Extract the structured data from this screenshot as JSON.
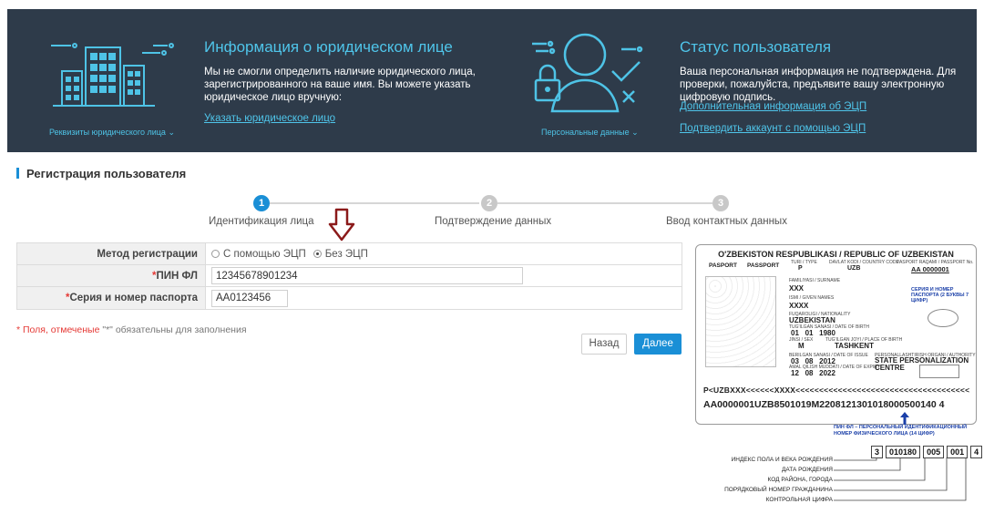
{
  "banner": {
    "legal": {
      "icon_caption": "Реквизиты юридического лица",
      "title": "Информация о юридическом лице",
      "text": "Мы не смогли определить наличие юридического лица, зарегистрированного на ваше имя. Вы можете указать юридическое лицо вручную:",
      "link": "Указать юридическое лицо"
    },
    "status": {
      "icon_caption": "Персональные данные",
      "title": "Статус пользователя",
      "text": "Ваша персональная информация не подтверждена. Для проверки, пожалуйста, предъявите вашу электронную цифровую подпись.",
      "info_link": "Дополнительная информация об ЭЦП",
      "confirm_link": "Подтвердить аккаунт с помощью ЭЦП"
    },
    "colors": {
      "background": "#2e3b4a",
      "accent": "#4fc5ea"
    }
  },
  "page": {
    "section_title": "Регистрация пользователя"
  },
  "stepper": {
    "steps": [
      {
        "number": "1",
        "label": "Идентификация лица",
        "state": "active"
      },
      {
        "number": "2",
        "label": "Подтверждение данных",
        "state": "inactive"
      },
      {
        "number": "3",
        "label": "Ввод контактных данных",
        "state": "inactive"
      }
    ]
  },
  "form": {
    "method": {
      "label": "Метод регистрации",
      "options": [
        "С помощью ЭЦП",
        "Без ЭЦП"
      ],
      "selected": "Без ЭЦП"
    },
    "pin": {
      "required_mark": "*",
      "label": "ПИН ФЛ",
      "value": "12345678901234"
    },
    "passport": {
      "required_mark": "*",
      "label": "Серия и номер паспорта",
      "value": "AA0123456"
    },
    "required_note_prefix": "* Поля, отмеченые ",
    "required_note_star": "\"*\"",
    "required_note_suffix": " обязательны для заполнения",
    "back_button": "Назад",
    "next_button": "Далее"
  },
  "passport_sample": {
    "header": "O'ZBEKISTON RESPUBLIKASI / REPUBLIC OF UZBEKISTAN",
    "pasport_label": "PASPORT",
    "passport_label": "PASSPORT",
    "type_label": "TURI / TYPE",
    "type_value": "P",
    "country_label": "DAVLAT KODI / COUNTRY CODE",
    "country_value": "UZB",
    "number_label": "PASPORT RAQAMI / PASSPORT No.",
    "number_value": "AA 0000001",
    "surname_label": "FAMILIYASI / SURNAME",
    "surname_value": "XXX",
    "given_label": "ISMI / GIVEN NAMES",
    "given_value": "XXXX",
    "nationality_label": "FUQAROLIGI / NATIONALITY",
    "nationality_value": "UZBEKISTAN",
    "dob_label": "TUG'ILGAN SANASI / DATE OF BIRTH",
    "dob_value": "01   01   1980",
    "sex_label": "JINSI / SEX",
    "sex_value": "M",
    "pob_label": "TUG'ILGAN JOYI / PLACE OF BIRTH",
    "pob_value": "TASHKENT",
    "issue_label": "BERILGAN SANASI / DATE OF ISSUE",
    "issue_value": "03   08   2012",
    "expiry_label": "AMAL QILISH MUDDATI / DATE OF EXPIRY",
    "expiry_value": "12   08   2022",
    "authority_label": "PERSONALLASHTIRISH ORGANI / AUTHORITY",
    "authority_value": "STATE PERSONALIZATION CENTRE",
    "series_note": "СЕРИЯ И НОМЕР ПАСПОРТА (2 БУКВЫ 7 ЦИФР)",
    "mrz1": "P<UZBXXX<<<<<<XXXX<<<<<<<<<<<<<<<<<<<<<<<<<<<<<<<<<<<<<",
    "mrz2": "AA0000001UZB8501019M2208121301018000500140 4",
    "pin_note": "ПИН ФЛ – ПЕРСОНАЛЬНЫЙ ИДЕНТИФИКАЦИОННЫЙ НОМЕР ФИЗИЧЕСКОГО ЛИЦА (14 ЦИФР)",
    "digit_groups": [
      "3",
      "010180",
      "005",
      "001",
      "4"
    ],
    "legend": [
      "ИНДЕКС ПОЛА И ВЕКА РОЖДЕНИЯ",
      "ДАТА РОЖДЕНИЯ",
      "КОД РАЙОНА, ГОРОДА",
      "ПОРЯДКОВЫЙ НОМЕР ГРАЖДАНИНА",
      "КОНТРОЛЬНАЯ ЦИФРА"
    ]
  }
}
